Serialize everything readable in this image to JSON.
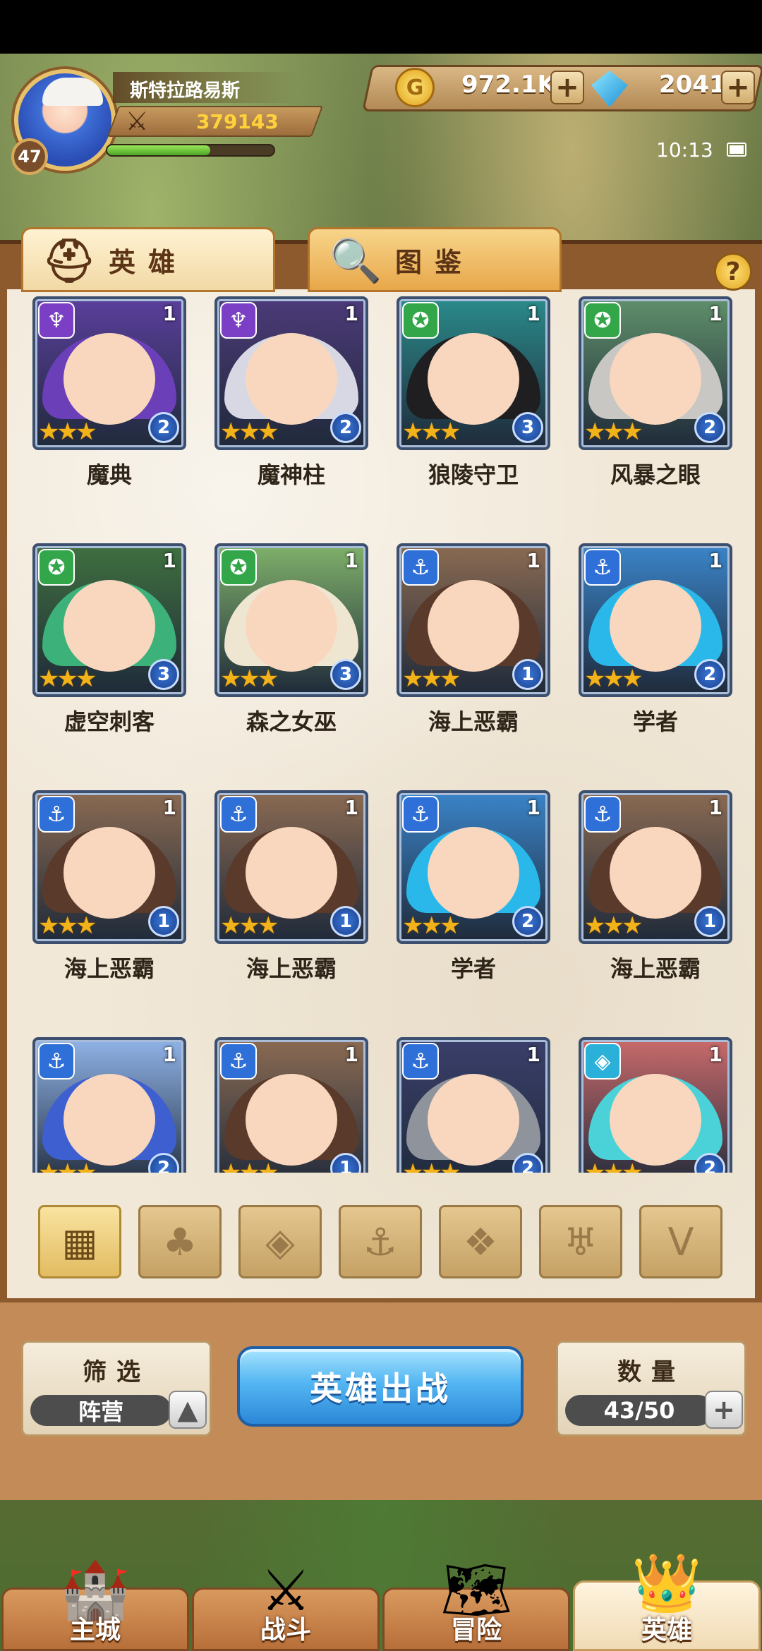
{
  "player": {
    "name": "斯特拉路易斯",
    "level": "47",
    "power": "379143",
    "exp_fraction": 0.62
  },
  "resources": {
    "gold": "972.1K",
    "gems": "2041",
    "plus": "+"
  },
  "status": {
    "time": "10:13"
  },
  "tabs": [
    {
      "label": "英雄",
      "icon": "helmet-icon"
    },
    {
      "label": "图鉴",
      "icon": "magnifier-icon"
    }
  ],
  "help_label": "?",
  "heroes": [
    {
      "name": "魔典",
      "faction": "demon",
      "level": "1",
      "rank": "2",
      "stars": "★★★",
      "hair": "#6a3fb8",
      "bg": "#5a3f9c"
    },
    {
      "name": "魔神柱",
      "faction": "demon",
      "level": "1",
      "rank": "2",
      "stars": "★★★",
      "hair": "#d8d8e4",
      "bg": "#4c3a78"
    },
    {
      "name": "狼陵守卫",
      "faction": "beast",
      "level": "1",
      "rank": "3",
      "stars": "★★★",
      "hair": "#1f1f22",
      "bg": "#2a8a8a"
    },
    {
      "name": "风暴之眼",
      "faction": "beast",
      "level": "1",
      "rank": "2",
      "stars": "★★★",
      "hair": "#c9c7c4",
      "bg": "#5f8f6a"
    },
    {
      "name": "虚空刺客",
      "faction": "beast",
      "level": "1",
      "rank": "3",
      "stars": "★★★",
      "hair": "#3cb27a",
      "bg": "#3f6f3f"
    },
    {
      "name": "森之女巫",
      "faction": "beast",
      "level": "1",
      "rank": "3",
      "stars": "★★★",
      "hair": "#efe6d2",
      "bg": "#7fb06a"
    },
    {
      "name": "海上恶霸",
      "faction": "sea",
      "level": "1",
      "rank": "1",
      "stars": "★★★",
      "hair": "#5a3a2a",
      "bg": "#8a6a52"
    },
    {
      "name": "学者",
      "faction": "sea",
      "level": "1",
      "rank": "2",
      "stars": "★★★",
      "hair": "#2ab8ea",
      "bg": "#3a84c8"
    },
    {
      "name": "海上恶霸",
      "faction": "sea",
      "level": "1",
      "rank": "1",
      "stars": "★★★",
      "hair": "#5a3a2a",
      "bg": "#8a6a52"
    },
    {
      "name": "海上恶霸",
      "faction": "sea",
      "level": "1",
      "rank": "1",
      "stars": "★★★",
      "hair": "#5a3a2a",
      "bg": "#8a6a52"
    },
    {
      "name": "学者",
      "faction": "sea",
      "level": "1",
      "rank": "2",
      "stars": "★★★",
      "hair": "#2ab8ea",
      "bg": "#3a84c8"
    },
    {
      "name": "海上恶霸",
      "faction": "sea",
      "level": "1",
      "rank": "1",
      "stars": "★★★",
      "hair": "#5a3a2a",
      "bg": "#8a6a52"
    },
    {
      "name": "",
      "faction": "sea",
      "level": "1",
      "rank": "2",
      "stars": "★★★",
      "hair": "#3e5fd0",
      "bg": "#8fb2e6"
    },
    {
      "name": "",
      "faction": "sea",
      "level": "1",
      "rank": "1",
      "stars": "★★★",
      "hair": "#5a3a2a",
      "bg": "#8a6a52"
    },
    {
      "name": "",
      "faction": "sea",
      "level": "1",
      "rank": "2",
      "stars": "★★★",
      "hair": "#8f949c",
      "bg": "#3a3f6a"
    },
    {
      "name": "",
      "faction": "holy",
      "level": "1",
      "rank": "2",
      "stars": "★★★",
      "hair": "#4ad2d8",
      "bg": "#c86a6a"
    }
  ],
  "filters": [
    {
      "icon": "grid-icon",
      "glyph": "▦"
    },
    {
      "icon": "forest-icon",
      "glyph": "♣"
    },
    {
      "icon": "diamond-icon",
      "glyph": "◈"
    },
    {
      "icon": "anchor-icon",
      "glyph": "⚓"
    },
    {
      "icon": "beast-icon",
      "glyph": "❖"
    },
    {
      "icon": "horns-icon",
      "glyph": "♅"
    },
    {
      "icon": "wings-icon",
      "glyph": "V"
    }
  ],
  "bottom": {
    "filter_title": "筛选",
    "filter_value": "阵营",
    "deploy_label": "英雄出战",
    "count_title": "数量",
    "count_value": "43/50"
  },
  "nav": [
    {
      "label": "主城",
      "icon": "castle-icon"
    },
    {
      "label": "战斗",
      "icon": "swords-icon"
    },
    {
      "label": "冒险",
      "icon": "map-icon"
    },
    {
      "label": "英雄",
      "icon": "hero-helmet-icon"
    }
  ]
}
